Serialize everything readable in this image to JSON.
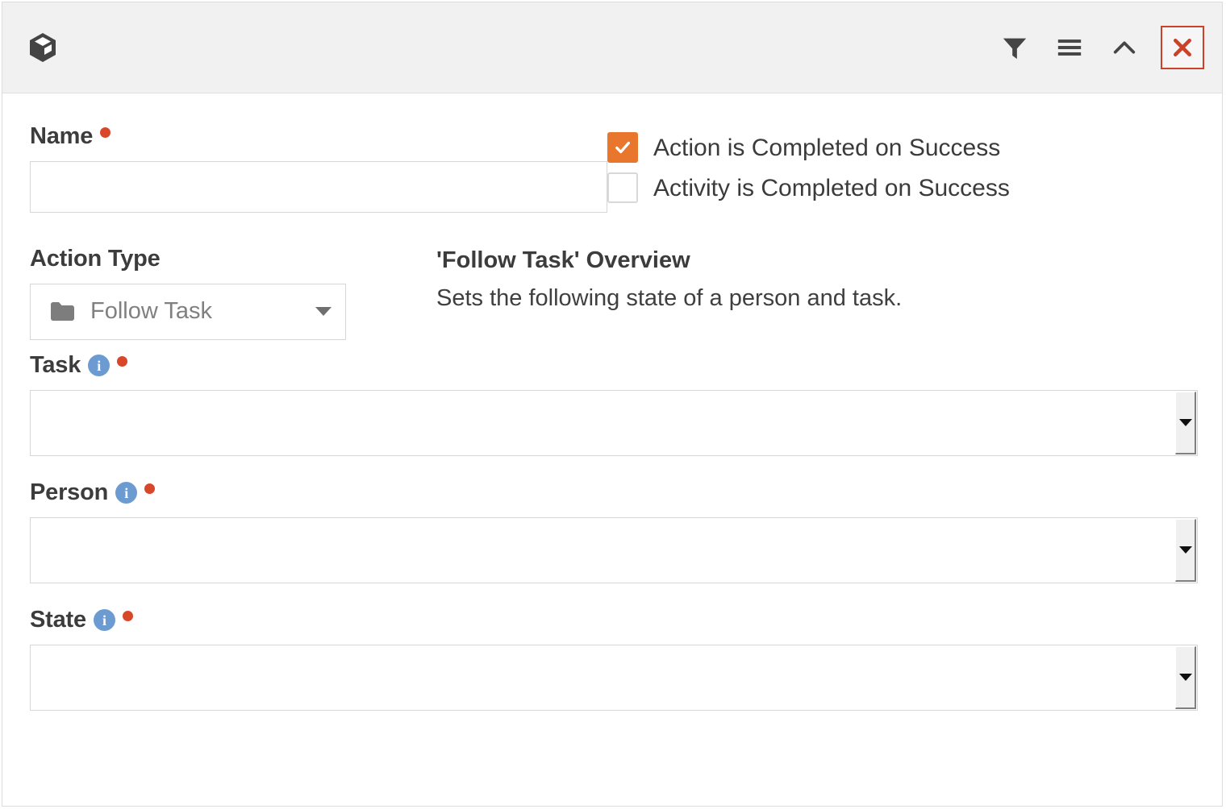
{
  "window": {
    "logo_icon": "box-cube-icon",
    "toolbar": [
      {
        "name": "filter-icon",
        "label": "Filter"
      },
      {
        "name": "menu-icon",
        "label": "Menu"
      },
      {
        "name": "chevron-up-icon",
        "label": "Collapse"
      },
      {
        "name": "close-icon",
        "label": "Close"
      }
    ]
  },
  "form": {
    "name": {
      "label": "Name",
      "required": true,
      "value": "",
      "placeholder": ""
    },
    "action_type": {
      "label": "Action Type",
      "required": false,
      "icon": "folder-icon",
      "selected": "Follow Task",
      "caret": "chevron-down-icon"
    },
    "task": {
      "label": "Task",
      "required": true,
      "info": "info-icon",
      "value": ""
    },
    "person": {
      "label": "Person",
      "required": true,
      "info": "info-icon",
      "value": ""
    },
    "state": {
      "label": "State",
      "required": true,
      "info": "info-icon",
      "value": ""
    },
    "info_glyph": "i"
  },
  "checkboxes": [
    {
      "label": "Action is Completed on Success",
      "checked": true
    },
    {
      "label": "Activity is Completed on Success",
      "checked": false
    }
  ],
  "overview": {
    "title": "'Follow Task' Overview",
    "description": "Sets the following state of a person and task."
  },
  "colors": {
    "accent_orange": "#e8762c",
    "required_red": "#d9472b",
    "close_red": "#cb4229",
    "info_blue": "#6c9bd2",
    "header_bg": "#f1f1f1",
    "border_gray": "#d6d6d6",
    "text_dark": "#3c3c3c"
  }
}
